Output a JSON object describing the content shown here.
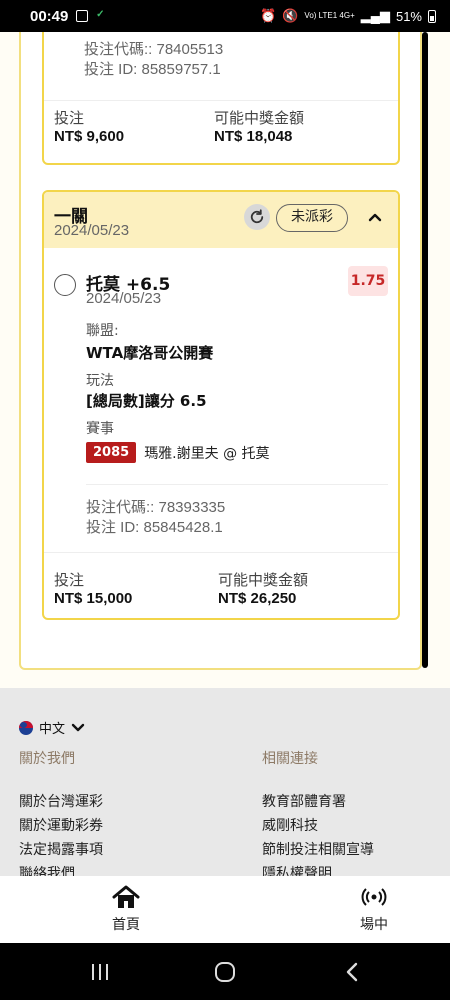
{
  "status_bar": {
    "time": "00:49",
    "network": "Vo) LTE1 4G+",
    "battery": "51%"
  },
  "bet_prev": {
    "code_line": "投注代碼:: 78405513",
    "id_line": "投注 ID: 85859757.1",
    "stake_label": "投注",
    "stake_value": "NT$ 9,600",
    "payout_label": "可能中獎金額",
    "payout_value": "NT$ 18,048"
  },
  "bet": {
    "type": "一關",
    "date": "2024/05/23",
    "status": "未派彩",
    "selection": "托莫 +6.5",
    "selection_date": "2024/05/23",
    "odds": "1.75",
    "league_label": "聯盟:",
    "league_value": "WTA摩洛哥公開賽",
    "play_label": "玩法",
    "play_value": "[總局數]讓分 6.5",
    "event_label": "賽事",
    "event_number": "2085",
    "event_name": "瑪雅.謝里夫 @ 托莫",
    "code_line": "投注代碼:: 78393335",
    "id_line": "投注 ID: 85845428.1",
    "stake_label": "投注",
    "stake_value": "NT$ 15,000",
    "payout_label": "可能中獎金額",
    "payout_value": "NT$ 26,250"
  },
  "footer": {
    "language": "中文",
    "col1_head": "關於我們",
    "col1_links": [
      "關於台灣運彩",
      "關於運動彩券",
      "法定揭露事項",
      "聯絡我們"
    ],
    "col2_head": "相關連接",
    "col2_links": [
      "教育部體育署",
      "威剛科技",
      "節制投注相關宣導",
      "隱私權聲明"
    ]
  },
  "nav": {
    "home": "首頁",
    "live": "場中"
  }
}
